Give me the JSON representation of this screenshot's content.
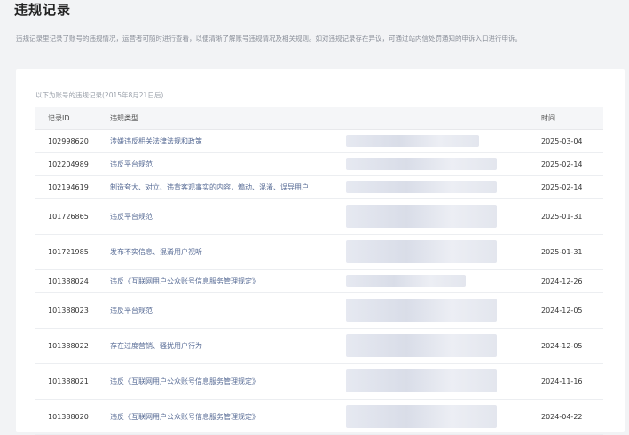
{
  "page": {
    "title": "违规记录",
    "description": "违规记录里记录了账号的违规情况，运营者可随时进行查看，以便清晰了解账号违规情况及相关规则。如对违规记录存在异议，可通过站内信处罚通知的申诉入口进行申诉。"
  },
  "table": {
    "caption": "以下为账号的违规记录(2015年8月21日后)",
    "headers": {
      "id": "记录ID",
      "type": "违规类型",
      "time": "时间"
    },
    "rows": [
      {
        "id": "102998620",
        "type": "涉嫌违反相关法律法规和政策",
        "time": "2025-03-04"
      },
      {
        "id": "102204989",
        "type": "违反平台规范",
        "time": "2025-02-14"
      },
      {
        "id": "102194619",
        "type": "制造夸大、对立、违背客观事实的内容，煽动、混淆、误导用户",
        "time": "2025-02-14"
      },
      {
        "id": "101726865",
        "type": "违反平台规范",
        "time": "2025-01-31"
      },
      {
        "id": "101721985",
        "type": "发布不实信息、混淆用户视听",
        "time": "2025-01-31"
      },
      {
        "id": "101388024",
        "type": "违反《互联网用户公众账号信息服务管理规定》",
        "time": "2024-12-26"
      },
      {
        "id": "101388023",
        "type": "违反平台规范",
        "time": "2024-12-05"
      },
      {
        "id": "101388022",
        "type": "存在过度营销、骚扰用户行为",
        "time": "2024-12-05"
      },
      {
        "id": "101388021",
        "type": "违反《互联网用户公众账号信息服务管理规定》",
        "time": "2024-11-16"
      },
      {
        "id": "101388020",
        "type": "违反《互联网用户公众账号信息服务管理规定》",
        "time": "2024-04-22"
      }
    ]
  }
}
